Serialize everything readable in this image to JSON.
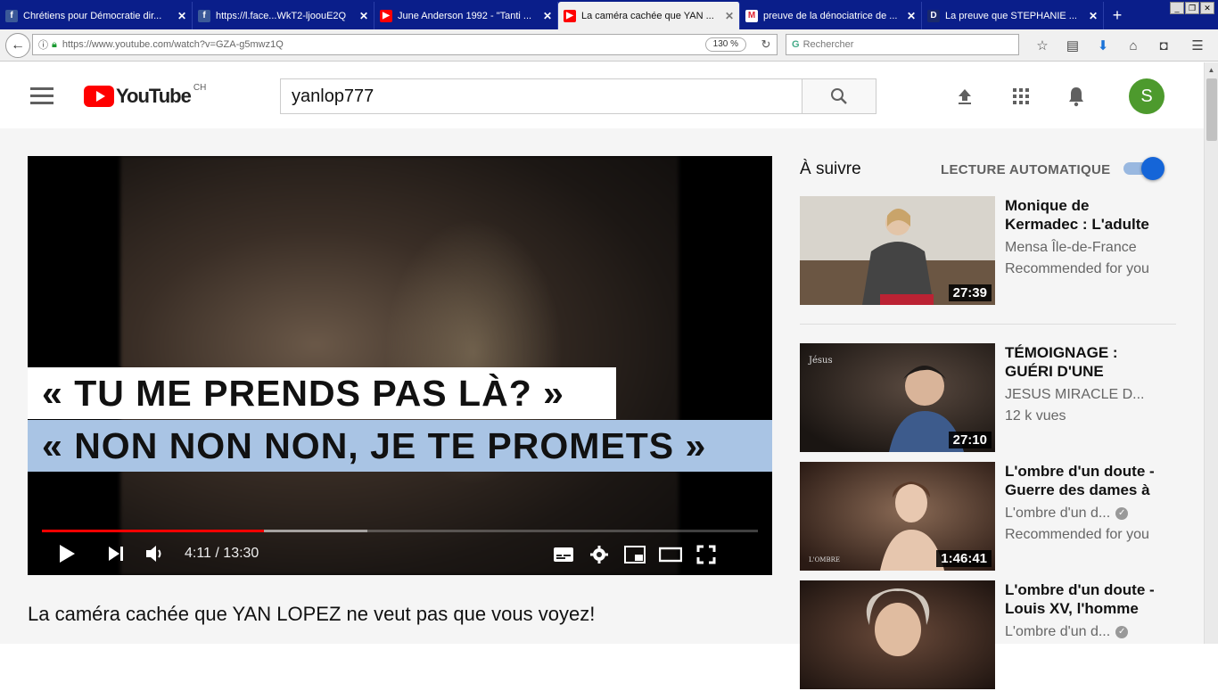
{
  "browser": {
    "tabs": [
      {
        "label": "Chrétiens pour Démocratie dir...",
        "favicon": "facebook-icon",
        "active": false
      },
      {
        "label": "https://l.face...WkT2-ljoouE2Q",
        "favicon": "facebook-icon",
        "active": false
      },
      {
        "label": "June Anderson 1992 - \"Tanti ...",
        "favicon": "youtube-icon",
        "active": false
      },
      {
        "label": "La caméra cachée que YAN ...",
        "favicon": "youtube-icon",
        "active": true
      },
      {
        "label": "preuve de la dénociatrice de ...",
        "favicon": "gmail-icon",
        "active": false
      },
      {
        "label": "La preuve que STEPHANIE ...",
        "favicon": "dailymotion-icon",
        "active": false
      }
    ],
    "tab_close": "✕",
    "new_tab": "+",
    "url": "https://www.youtube.com/watch?v=GZA-g5mwz1Q",
    "zoom": "130 %",
    "search_placeholder": "Rechercher"
  },
  "youtube": {
    "logo_text": "YouTube",
    "region": "CH",
    "search_value": "yanlop777",
    "avatar_letter": "S",
    "accent": "#ff0000",
    "avatar_color": "#4d9a2d"
  },
  "player": {
    "caption_line1": "« TU ME PRENDS PAS LÀ? »",
    "caption_line2": "« NON NON NON, JE TE PROMETS »",
    "time": "4:11 / 13:30",
    "progress_played": 0.31,
    "progress_buffered": 0.455
  },
  "video_title": "La caméra cachée que YAN LOPEZ ne veut pas que vous voyez!",
  "sidebar": {
    "up_next": "À suivre",
    "autoplay_label": "LECTURE AUTOMATIQUE",
    "autoplay_on": true,
    "recommendations": [
      {
        "title": "Monique de Kermadec : L'adulte",
        "channel": "Mensa Île-de-France",
        "meta": "Recommended for you",
        "duration": "27:39",
        "verified": false
      },
      {
        "title": "TÉMOIGNAGE : GUÉRI D'UNE",
        "channel": "JESUS MIRACLE D...",
        "meta": "12 k vues",
        "duration": "27:10",
        "verified": false
      },
      {
        "title": "L'ombre d'un doute - Guerre des dames à",
        "channel": "L'ombre d'un d...",
        "meta": "Recommended for you",
        "duration": "1:46:41",
        "verified": true
      },
      {
        "title": "L'ombre d'un doute - Louis XV, l'homme",
        "channel": "L'ombre d'un d...",
        "meta": "",
        "duration": "",
        "verified": true
      }
    ]
  }
}
